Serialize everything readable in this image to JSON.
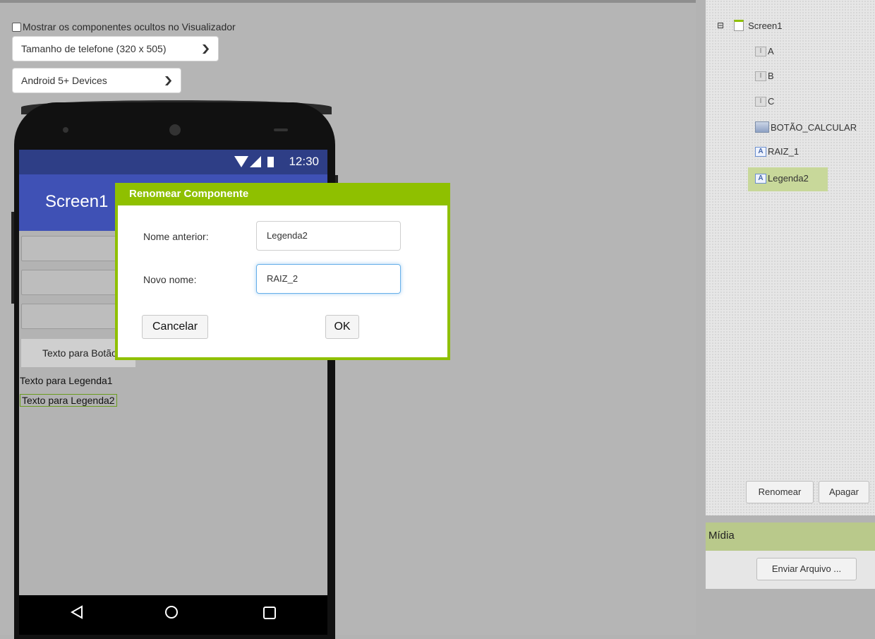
{
  "viewer": {
    "show_hidden_label": "Mostrar os componentes ocultos no Visualizador",
    "phone_size_select": "Tamanho de telefone (320 x 505)",
    "device_select": "Android 5+ Devices"
  },
  "phone": {
    "status_time": "12:30",
    "screen_title": "Screen1",
    "button_text": "Texto para Botão",
    "label1_text": "Texto para Legenda1",
    "label2_text": "Texto para Legenda2"
  },
  "dialog": {
    "title": "Renomear Componente",
    "old_name_label": "Nome anterior:",
    "old_name_value": "Legenda2",
    "new_name_label": "Novo nome:",
    "new_name_value": "RAIZ_2",
    "cancel_label": "Cancelar",
    "ok_label": "OK"
  },
  "components": {
    "root": "Screen1",
    "items": [
      {
        "name": "A",
        "icon": "textbox-icon"
      },
      {
        "name": "B",
        "icon": "textbox-icon"
      },
      {
        "name": "C",
        "icon": "textbox-icon"
      },
      {
        "name": "BOTÃO_CALCULAR",
        "icon": "button-icon"
      },
      {
        "name": "RAIZ_1",
        "icon": "label-icon"
      },
      {
        "name": "Legenda2",
        "icon": "label-icon",
        "selected": true
      }
    ],
    "rename_label": "Renomear",
    "delete_label": "Apagar"
  },
  "media": {
    "title": "Mídia",
    "upload_label": "Enviar Arquivo ..."
  },
  "colors": {
    "dialog_accent": "#8fc000",
    "app_bar": "#3f51b5",
    "status_bar": "#2e3e86"
  }
}
